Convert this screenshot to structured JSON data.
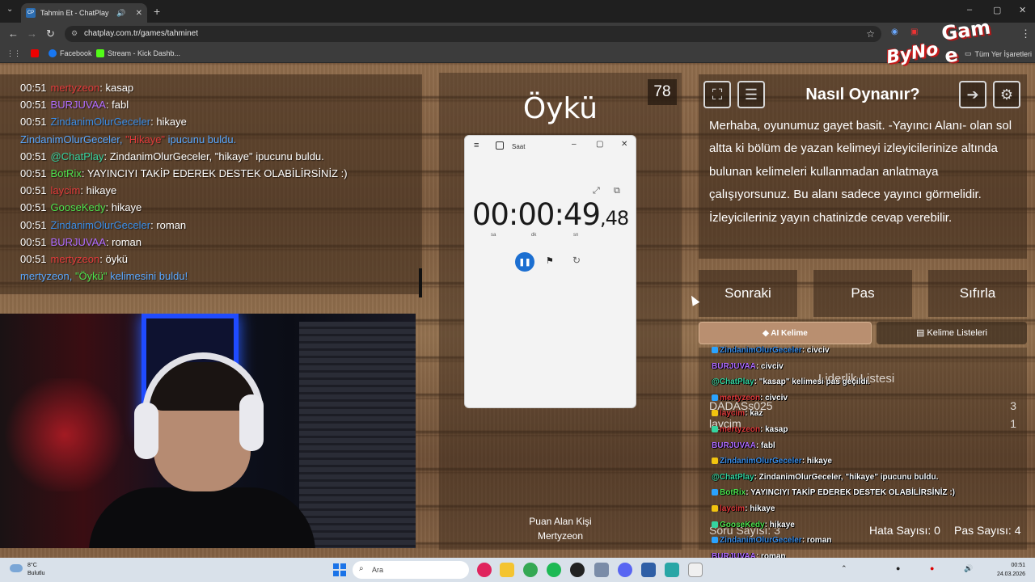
{
  "browser": {
    "tab_title": "Tahmin Et - ChatPlay",
    "tab_favicon": "CP",
    "url": "chatplay.com.tr/games/tahminet",
    "bookmarks": [
      "Facebook",
      "Stream - Kick Dashb..."
    ],
    "all_bookmarks": "Tüm Yer İşaretleri"
  },
  "logo": {
    "top": "Gam e",
    "bottom": "ByNo"
  },
  "chat": [
    {
      "time": "00:51",
      "user": "mertyzeon",
      "color": "red",
      "msg": ": kasap"
    },
    {
      "time": "00:51",
      "user": "BURJUVAA",
      "color": "purple",
      "msg": ": fabl"
    },
    {
      "time": "00:51",
      "user": "ZindanimOlurGeceler",
      "color": "blue",
      "msg": ": hikaye"
    },
    {
      "time": "",
      "user": "ZindanimOlurGeceler,",
      "color": "blue",
      "msg": "",
      "system": true,
      "hl": "\"Hikaye\"",
      "tail": " ipucunu buldu."
    },
    {
      "time": "00:51",
      "user": "@ChatPlay",
      "color": "teal",
      "msg": ": ZindanimOlurGeceler, \"hikaye\" ipucunu buldu."
    },
    {
      "time": "00:51",
      "user": "BotRix",
      "color": "green",
      "msg": ": YAYINCIYI TAKİP EDEREK DESTEK OLABİLİRSİNİZ :)"
    },
    {
      "time": "00:51",
      "user": "laycim",
      "color": "red",
      "msg": ": hikaye"
    },
    {
      "time": "00:51",
      "user": "GooseKedy",
      "color": "green",
      "msg": ": hikaye"
    },
    {
      "time": "00:51",
      "user": "ZindanimOlurGeceler",
      "color": "blue",
      "msg": ": roman"
    },
    {
      "time": "00:51",
      "user": "BURJUVAA",
      "color": "purple",
      "msg": ": roman"
    },
    {
      "time": "00:51",
      "user": "mertyzeon",
      "color": "red",
      "msg": ": öykü"
    },
    {
      "time": "",
      "user": "mertyzeon,",
      "color": "blue",
      "msg": "",
      "system": true,
      "hl": "\"Öykü\"",
      "hlcolor": "green",
      "tail": " kelimesini buldu!"
    }
  ],
  "game": {
    "word": "Öykü",
    "counter": "78",
    "scorer_label": "Puan Alan Kişi",
    "scorer_name": "Mertyzeon"
  },
  "clock_app": {
    "title": "Saat",
    "time_main": "00:00:49",
    "time_ms": ",48",
    "units": [
      "sa",
      "dk",
      "sn"
    ]
  },
  "help": {
    "title": "Nasıl Oynanır?",
    "text": "Merhaba, oyunumuz gayet basit. -Yayıncı Alanı- olan sol altta ki bölüm de yazan kelimeyi izleyicilerinize altında bulunan kelimeleri kullanmadan anlatmaya çalışıyorsunuz. Bu alanı sadece yayıncı görmelidir. İzleyicileriniz yayın chatinizde cevap verebilir."
  },
  "actions": {
    "next": "Sonraki",
    "pass": "Pas",
    "reset": "Sıfırla"
  },
  "tabs": {
    "ai": "AI Kelime",
    "lists": "Kelime Listeleri"
  },
  "leaderboard": {
    "title": "Liderlik Listesi",
    "rows": [
      {
        "name": "DADASs025",
        "score": "3"
      },
      {
        "name": "laycim",
        "score": "1"
      }
    ],
    "question_count_label": "Soru Sayısı: 3",
    "error_count": "Hata Sayısı: 0",
    "pass_count": "Pas Sayısı: 4"
  },
  "overlay_chat": [
    {
      "user": "ZindanimOlurGeceler",
      "color": "blue",
      "msg": ": civciv"
    },
    {
      "user": "BURJUVAA",
      "color": "purple",
      "msg": ": civciv"
    },
    {
      "user": "@ChatPlay",
      "color": "teal",
      "msg": ": \"kasap\" kelimesi pas geçildi."
    },
    {
      "user": "mertyzeon",
      "color": "red",
      "msg": ": civciv"
    },
    {
      "user": "laycim",
      "color": "red",
      "msg": ": kaz"
    },
    {
      "user": "mertyzeon",
      "color": "red",
      "msg": ": kasap"
    },
    {
      "user": "BURJUVAA",
      "color": "purple",
      "msg": ": fabl"
    },
    {
      "user": "ZindanimOlurGeceler",
      "color": "blue",
      "msg": ": hikaye"
    },
    {
      "user": "@ChatPlay",
      "color": "teal",
      "msg": ": ZindanimOlurGeceler, \"hikaye\" ipucunu buldu."
    },
    {
      "user": "BotRix",
      "color": "green",
      "msg": ": YAYINCIYI TAKİP EDEREK DESTEK OLABİLİRSİNİZ :)"
    },
    {
      "user": "laycim",
      "color": "red",
      "msg": ": hikaye"
    },
    {
      "user": "GooseKedy",
      "color": "green",
      "msg": ": hikaye"
    },
    {
      "user": "ZindanimOlurGeceler",
      "color": "blue",
      "msg": ": roman"
    },
    {
      "user": "BURJUVAA",
      "color": "purple",
      "msg": ": roman"
    }
  ],
  "taskbar": {
    "temp": "8°C",
    "weather": "Bulutlu",
    "search": "Ara",
    "time": "00:51",
    "date": "24.03.2026"
  }
}
